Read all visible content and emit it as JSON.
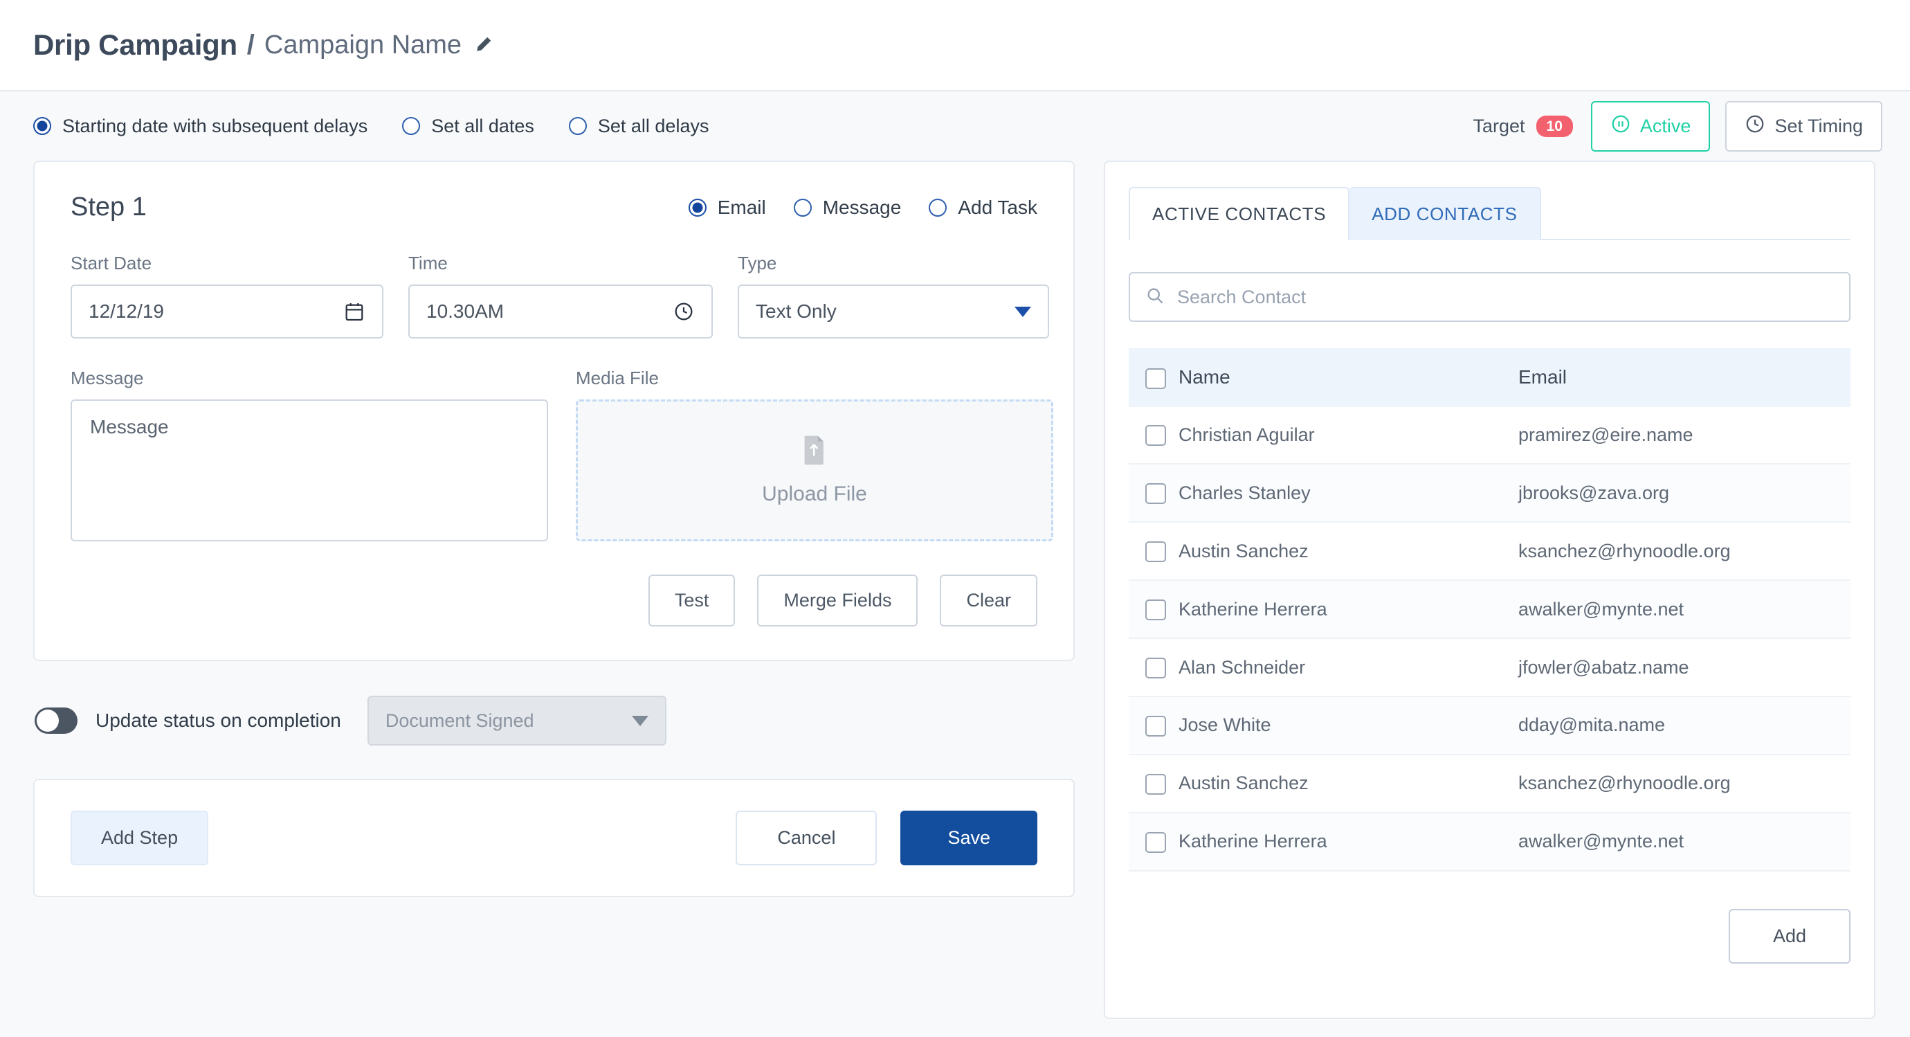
{
  "header": {
    "title": "Drip Campaign",
    "separator": "/",
    "subtitle": "Campaign Name"
  },
  "toolbar": {
    "scheduling_modes": [
      {
        "label": "Starting date with subsequent delays",
        "selected": true
      },
      {
        "label": "Set all dates",
        "selected": false
      },
      {
        "label": "Set all delays",
        "selected": false
      }
    ],
    "target_label": "Target",
    "target_count": "10",
    "active_button": "Active",
    "set_timing_button": "Set Timing"
  },
  "step": {
    "title": "Step 1",
    "modes": [
      {
        "label": "Email",
        "selected": true
      },
      {
        "label": "Message",
        "selected": false
      },
      {
        "label": "Add Task",
        "selected": false
      }
    ],
    "start_date": {
      "label": "Start Date",
      "value": "12/12/19"
    },
    "time": {
      "label": "Time",
      "value": "10.30AM"
    },
    "type": {
      "label": "Type",
      "value": "Text Only"
    },
    "message": {
      "label": "Message",
      "placeholder": "Message",
      "value": ""
    },
    "media": {
      "label": "Media File",
      "upload_text": "Upload File"
    },
    "buttons": {
      "test": "Test",
      "merge_fields": "Merge Fields",
      "clear": "Clear"
    }
  },
  "status_update": {
    "toggle_on": false,
    "label": "Update status on completion",
    "select_value": "Document Signed"
  },
  "footer": {
    "add_step": "Add Step",
    "cancel": "Cancel",
    "save": "Save"
  },
  "contacts": {
    "tabs": [
      {
        "label": "ACTIVE CONTACTS",
        "active": true
      },
      {
        "label": "ADD CONTACTS",
        "active": false
      }
    ],
    "search_placeholder": "Search Contact",
    "columns": {
      "name": "Name",
      "email": "Email"
    },
    "rows": [
      {
        "name": "Christian Aguilar",
        "email": "pramirez@eire.name"
      },
      {
        "name": "Charles Stanley",
        "email": "jbrooks@zava.org"
      },
      {
        "name": "Austin Sanchez",
        "email": "ksanchez@rhynoodle.org"
      },
      {
        "name": "Katherine Herrera",
        "email": "awalker@mynte.net"
      },
      {
        "name": "Alan Schneider",
        "email": "jfowler@abatz.name"
      },
      {
        "name": "Jose White",
        "email": "dday@mita.name"
      },
      {
        "name": "Austin Sanchez",
        "email": "ksanchez@rhynoodle.org"
      },
      {
        "name": "Katherine Herrera",
        "email": "awalker@mynte.net"
      }
    ],
    "add_button": "Add"
  },
  "colors": {
    "accent_blue": "#124e9d",
    "active_green": "#1fd1a5",
    "badge_red": "#f4616e",
    "page_bg": "#f7f9fb"
  }
}
